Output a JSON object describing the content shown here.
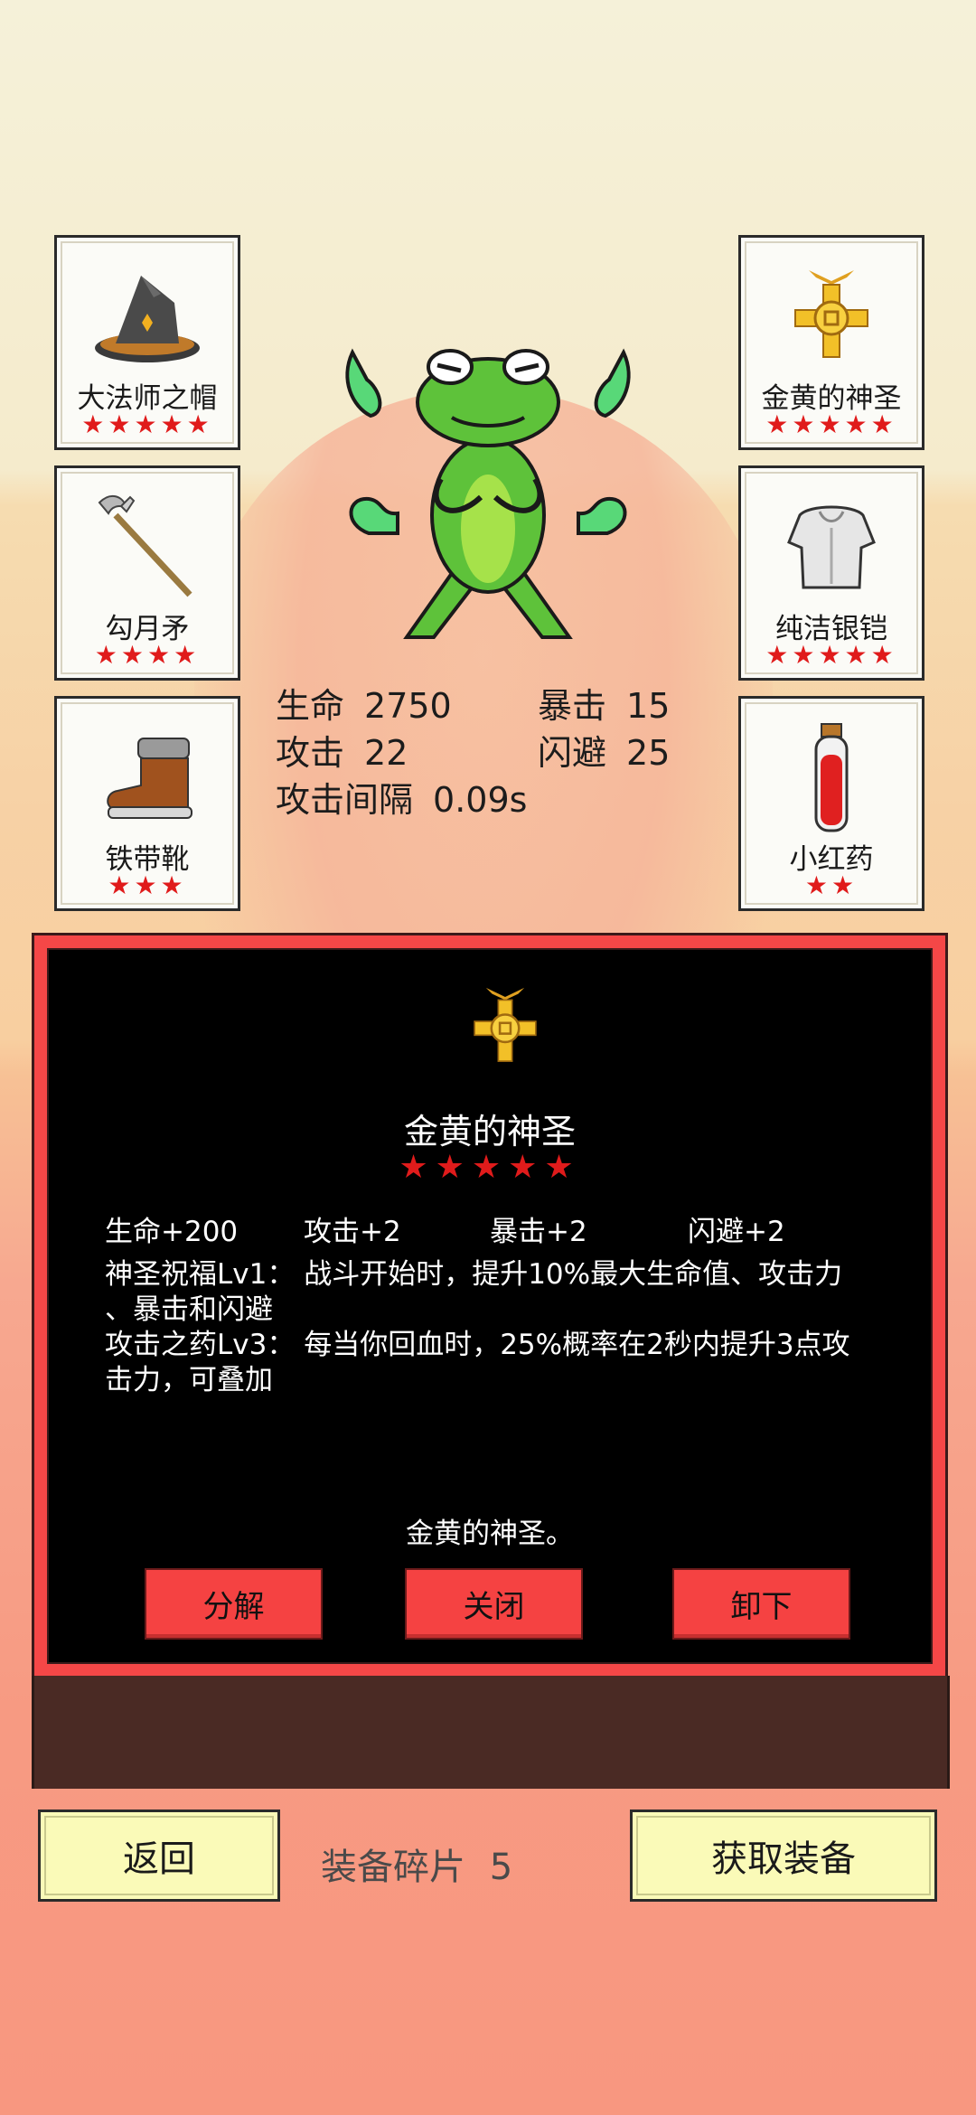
{
  "equipment": {
    "left": [
      {
        "name": "大法师之帽",
        "stars": "★★★★★",
        "icon": "wizard-hat-icon"
      },
      {
        "name": "勾月矛",
        "stars": "★★★★",
        "icon": "spear-icon"
      },
      {
        "name": "铁带靴",
        "stars": "★★★",
        "icon": "boot-icon"
      }
    ],
    "right": [
      {
        "name": "金黄的神圣",
        "stars": "★★★★★",
        "icon": "golden-holy-amulet-icon"
      },
      {
        "name": "纯洁银铠",
        "stars": "★★★★★",
        "icon": "silver-armor-icon"
      },
      {
        "name": "小红药",
        "stars": "★★",
        "icon": "red-potion-icon"
      }
    ]
  },
  "stats": {
    "hp_label": "生命",
    "hp_value": "2750",
    "crit_label": "暴击",
    "crit_value": "15",
    "atk_label": "攻击",
    "atk_value": "22",
    "dodge_label": "闪避",
    "dodge_value": "25",
    "interval_label": "攻击间隔",
    "interval_value": "0.09s"
  },
  "dialog": {
    "title": "金黄的神圣",
    "stars": "★★★★★",
    "attributes": [
      "生命+200",
      "攻击+2",
      "暴击+2",
      "闪避+2"
    ],
    "desc_lines": [
      "神圣祝福Lv1：  战斗开始时，提升10%最大生命值、攻击力",
      "、暴击和闪避",
      "攻击之药Lv3：  每当你回血时，25%概率在2秒内提升3点攻",
      "击力，可叠加"
    ],
    "flavor": "金黄的神圣。",
    "buttons": {
      "decompose": "分解",
      "close": "关闭",
      "unequip": "卸下"
    }
  },
  "footer": {
    "back": "返回",
    "shards_label": "装备碎片",
    "shards_value": "5",
    "get_equipment": "获取装备"
  },
  "colors": {
    "star": "#e01b1b",
    "button_red": "#f54242",
    "bottom_button": "#fafab8",
    "frog_green": "#5ec23a"
  }
}
